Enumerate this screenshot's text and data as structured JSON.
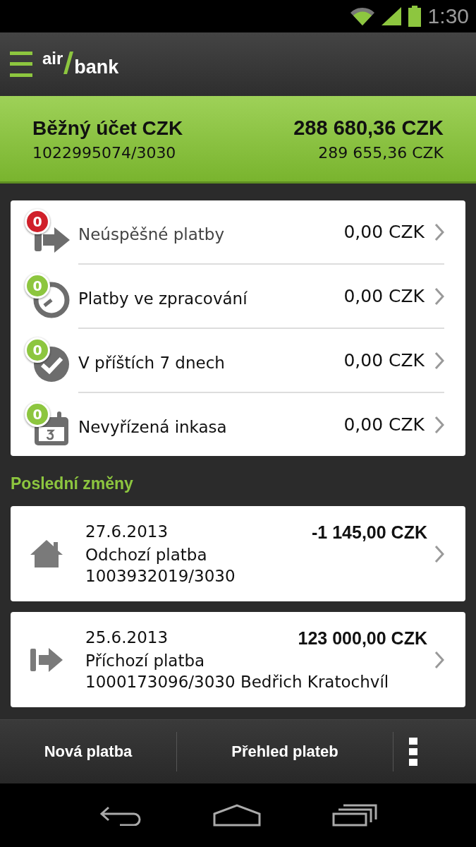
{
  "status_bar": {
    "time": "1:30"
  },
  "app_bar": {
    "logo": [
      "air",
      "bank"
    ]
  },
  "account": {
    "name": "Běžný účet CZK",
    "number": "1022995074/3030",
    "balance": "288 680,36 CZK",
    "available": "289 655,36 CZK"
  },
  "summary": [
    {
      "kind": "failed",
      "count": "0",
      "color": "#d0202a",
      "label": "Neúspěšné platby",
      "amount": "0,00 CZK"
    },
    {
      "kind": "processing",
      "count": "0",
      "color": "#8dc63f",
      "label": "Platby ve zpracování",
      "amount": "0,00 CZK"
    },
    {
      "kind": "scheduled",
      "count": "0",
      "color": "#8dc63f",
      "label": "V příštích 7 dnech",
      "amount": "0,00 CZK"
    },
    {
      "kind": "collection",
      "count": "0",
      "color": "#8dc63f",
      "label": "Nevyřízená inkasa",
      "amount": "0,00 CZK"
    }
  ],
  "recent_title": "Poslední změny",
  "transactions": [
    {
      "kind": "outgoing",
      "date": "27.6.2013",
      "type": "Odchozí platba",
      "account": "1003932019/3030",
      "amount": "-1 145,00 CZK"
    },
    {
      "kind": "incoming",
      "date": "25.6.2013",
      "type": "Příchozí platba",
      "account": "1000173096/3030 Bedřich Kratochvíl",
      "amount": "123 000,00 CZK"
    }
  ],
  "actions": [
    "Nová platba",
    "Přehled plateb"
  ]
}
